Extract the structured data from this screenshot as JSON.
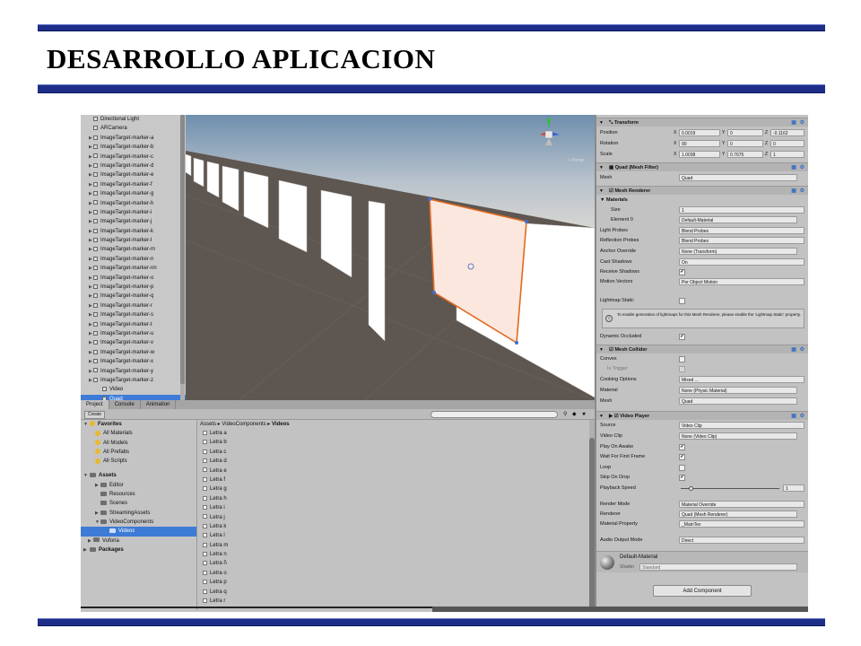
{
  "slide": {
    "title": "DESARROLLO APLICACION"
  },
  "colors": {
    "rule": "#1e2e88",
    "selection": "#3d7bd6",
    "quad_outline": "#e06a20"
  },
  "hierarchy": {
    "items": [
      "Directional Light",
      "ARCamera",
      "ImageTarget-marker-a",
      "ImageTarget-marker-b",
      "ImageTarget-marker-c",
      "ImageTarget-marker-d",
      "ImageTarget-marker-e",
      "ImageTarget-marker-f",
      "ImageTarget-marker-g",
      "ImageTarget-marker-h",
      "ImageTarget-marker-i",
      "ImageTarget-marker-j",
      "ImageTarget-marker-k",
      "ImageTarget-marker-l",
      "ImageTarget-marker-m",
      "ImageTarget-marker-n",
      "ImageTarget-marker-nn",
      "ImageTarget-marker-o",
      "ImageTarget-marker-p",
      "ImageTarget-marker-q",
      "ImageTarget-marker-r",
      "ImageTarget-marker-s",
      "ImageTarget-marker-t",
      "ImageTarget-marker-u",
      "ImageTarget-marker-v",
      "ImageTarget-marker-w",
      "ImageTarget-marker-x",
      "ImageTarget-marker-y",
      "ImageTarget-marker-z"
    ],
    "children": [
      "Video",
      "Quad"
    ]
  },
  "scene": {
    "persp_label": "< Persp"
  },
  "project": {
    "tabs": [
      "Project",
      "Console",
      "Animation"
    ],
    "create_label": "Create",
    "favorites": {
      "label": "Favorites",
      "items": [
        "All Materials",
        "All Models",
        "All Prefabs",
        "All Scripts"
      ]
    },
    "assets": {
      "label": "Assets",
      "items": [
        "Editor",
        "Resources",
        "Scenes",
        "StreamingAssets",
        "VideoComponents"
      ]
    },
    "videos_folder": "Videos",
    "vuforia": "Vuforia",
    "packages": "Packages",
    "breadcrumb": {
      "a": "Assets",
      "b": "VideoComponents",
      "c": "Videos"
    },
    "files": [
      "Letra a",
      "Letra b",
      "Letra c",
      "Letra d",
      "Letra e",
      "Letra f",
      "Letra g",
      "Letra h",
      "Letra i",
      "Letra j",
      "Letra k",
      "Letra l",
      "Letra m",
      "Letra n",
      "Letra ñ",
      "Letra o",
      "Letra p",
      "Letra q",
      "Letra r"
    ]
  },
  "inspector": {
    "transform": {
      "title": "Transform",
      "position": {
        "label": "Position",
        "x": "0.0019",
        "y": "0",
        "z": "-0.1162"
      },
      "rotation": {
        "label": "Rotation",
        "x": "90",
        "y": "0",
        "z": "0"
      },
      "scale": {
        "label": "Scale",
        "x": "1.0038",
        "y": "0.7675",
        "z": "1"
      }
    },
    "mesh_filter": {
      "title": "Quad (Mesh Filter)",
      "mesh_label": "Mesh",
      "mesh_value": "Quad"
    },
    "mesh_renderer": {
      "title": "Mesh Renderer",
      "materials": "Materials",
      "size_label": "Size",
      "size_value": "1",
      "element_label": "Element 0",
      "element_value": "Default-Material",
      "light_probes_label": "Light Probes",
      "light_probes_value": "Blend Probes",
      "reflection_label": "Reflection Probes",
      "reflection_value": "Blend Probes",
      "anchor_label": "Anchor Override",
      "anchor_value": "None (Transform)",
      "cast_label": "Cast Shadows",
      "cast_value": "On",
      "receive_label": "Receive Shadows",
      "motion_label": "Motion Vectors",
      "motion_value": "Per Object Motion",
      "lightmap_label": "Lightmap Static",
      "help_text": "To enable generation of lightmaps for this Mesh Renderer, please enable the 'Lightmap Static' property.",
      "dynamic_label": "Dynamic Occluded"
    },
    "mesh_collider": {
      "title": "Mesh Collider",
      "convex_label": "Convex",
      "trigger_label": "Is Trigger",
      "cooking_label": "Cooking Options",
      "cooking_value": "Mixed ...",
      "material_label": "Material",
      "material_value": "None (Physic Material)",
      "mesh_label": "Mesh",
      "mesh_value": "Quad"
    },
    "video_player": {
      "title": "Video Player",
      "source_label": "Source",
      "source_value": "Video Clip",
      "clip_label": "Video Clip",
      "clip_value": "None (Video Clip)",
      "play_label": "Play On Awake",
      "wait_label": "Wait For First Frame",
      "loop_label": "Loop",
      "skip_label": "Skip On Drop",
      "speed_label": "Playback Speed",
      "speed_value": "1",
      "speed_level": 0.1,
      "render_label": "Render Mode",
      "render_value": "Material Override",
      "renderer_label": "Renderer",
      "renderer_value": "Quad (Mesh Renderer)",
      "matprop_label": "Material Property",
      "matprop_value": "_MainTex",
      "audio_label": "Audio Output Mode",
      "audio_value": "Direct"
    },
    "material": {
      "name": "Default-Material",
      "shader_label": "Shader",
      "shader_value": "Standard"
    },
    "add_component": "Add Component"
  }
}
